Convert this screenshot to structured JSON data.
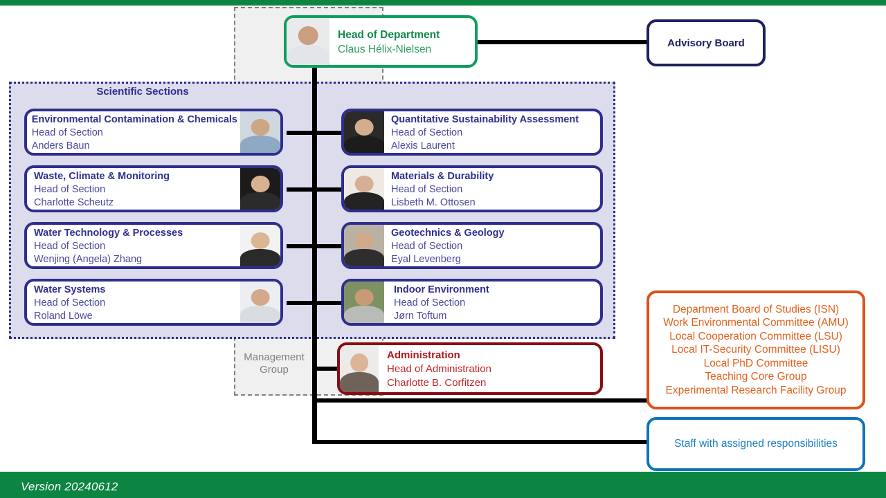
{
  "meta": {
    "version_label": "Version 20240612"
  },
  "containers": {
    "management_group": "Management\nGroup",
    "management_group_line1": "Management",
    "management_group_line2": "Group",
    "scientific_sections_title": "Scientific Sections"
  },
  "head_of_department": {
    "role": "Head of Department",
    "name": "Claus Hélix-Nielsen",
    "accent": "#0f9e5e",
    "photo": "portrait-claus-helix-nielsen"
  },
  "advisory_board": {
    "label": "Advisory Board",
    "accent": "#1f2060"
  },
  "sections_left": [
    {
      "title": "Environmental Contamination & Chemicals",
      "role": "Head of Section",
      "name": "Anders Baun",
      "photo": "portrait-anders-baun"
    },
    {
      "title": "Waste, Climate & Monitoring",
      "role": "Head of Section",
      "name": "Charlotte Scheutz",
      "photo": "portrait-charlotte-scheutz"
    },
    {
      "title": "Water Technology & Processes",
      "role": "Head of Section",
      "name": "Wenjing (Angela) Zhang",
      "photo": "portrait-wenjing-angela-zhang"
    },
    {
      "title": "Water Systems",
      "role": "Head of Section",
      "name": "Roland Löwe",
      "photo": "portrait-roland-lowe"
    }
  ],
  "sections_right": [
    {
      "title": "Quantitative Sustainability Assessment",
      "role": "Head of Section",
      "name": "Alexis Laurent",
      "photo": "portrait-alexis-laurent"
    },
    {
      "title": "Materials & Durability",
      "role": "Head of Section",
      "name": "Lisbeth M. Ottosen",
      "photo": "portrait-lisbeth-m-ottosen"
    },
    {
      "title": "Geotechnics & Geology",
      "role": "Head of Section",
      "name": "Eyal Levenberg",
      "photo": "portrait-eyal-levenberg"
    },
    {
      "title": "Indoor Environment",
      "role": "Head of Section",
      "name": "Jørn Toftum",
      "photo": "portrait-jorn-toftum"
    }
  ],
  "administration": {
    "title": "Administration",
    "role": "Head of Administration",
    "name": "Charlotte B. Corfitzen",
    "accent": "#8b0b12",
    "photo": "portrait-charlotte-b-corfitzen"
  },
  "committees": {
    "accent": "#d9531e",
    "items": [
      "Department Board of Studies (ISN)",
      "Work Environmental Committee (AMU)",
      "Local Cooperation Committee (LSU)",
      "Local IT-Security Committee (LISU)",
      "Local PhD Committee",
      "Teaching Core Group",
      "Experimental Research Facility Group"
    ]
  },
  "staff": {
    "label": "Staff with assigned responsibilities",
    "accent": "#1074b8"
  },
  "colors": {
    "brand_green": "#0c8442",
    "section_blue": "#2e2e8f",
    "sections_panel_bg": "#dcdcec",
    "mgmt_bg": "#f0f0f0",
    "mgmt_border": "#808080"
  }
}
